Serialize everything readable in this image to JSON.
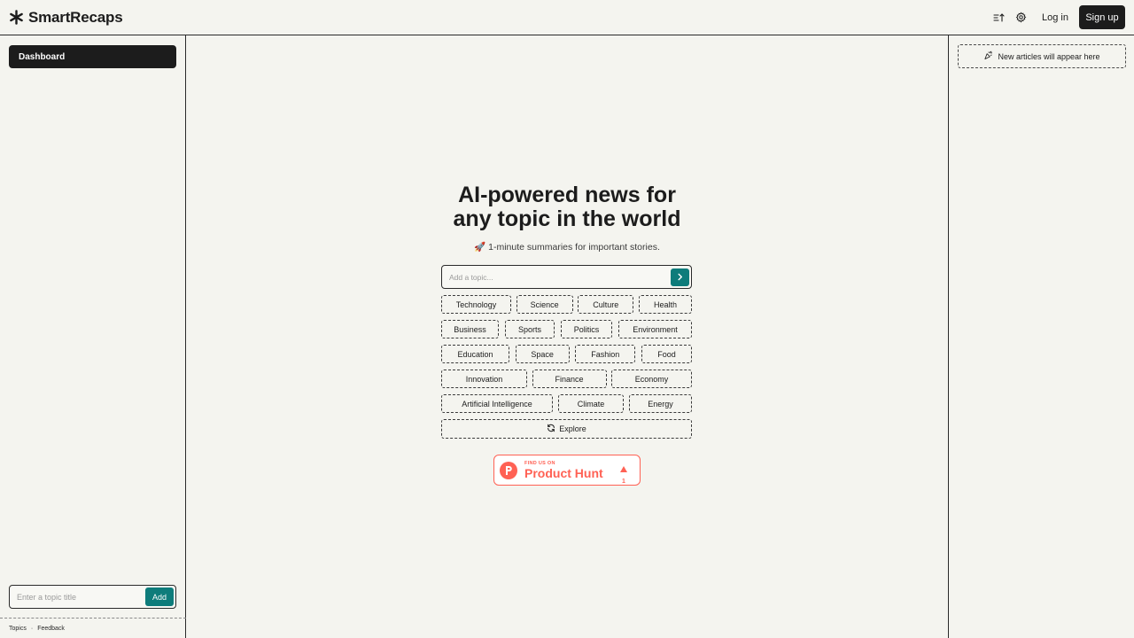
{
  "header": {
    "brand_name": "SmartRecaps",
    "login_label": "Log in",
    "signup_label": "Sign up"
  },
  "sidebar": {
    "dashboard_label": "Dashboard",
    "topic_input_placeholder": "Enter a topic title",
    "add_label": "Add",
    "footer_topics": "Topics",
    "footer_separator": "·",
    "footer_feedback": "Feedback"
  },
  "right_panel": {
    "new_articles_label": "New articles will appear here"
  },
  "main": {
    "title_line1": "AI-powered news for",
    "title_line2": "any topic in the world",
    "subtitle": "🚀 1-minute summaries for important stories.",
    "search_placeholder": "Add a topic...",
    "topic_rows": [
      [
        "Technology",
        "Science",
        "Culture",
        "Health"
      ],
      [
        "Business",
        "Sports",
        "Politics",
        "Environment"
      ],
      [
        "Education",
        "Space",
        "Fashion",
        "Food"
      ],
      [
        "Innovation",
        "Finance",
        "Economy"
      ],
      [
        "Artificial Intelligence",
        "Climate",
        "Energy"
      ]
    ],
    "explore_label": "Explore"
  },
  "product_hunt": {
    "small_text": "FIND US ON",
    "big_text": "Product Hunt",
    "votes": "1"
  },
  "colors": {
    "accent": "#0e7c7b",
    "dark": "#1c1c1c",
    "background": "#f4f4ef",
    "product_hunt": "#ff6154"
  }
}
